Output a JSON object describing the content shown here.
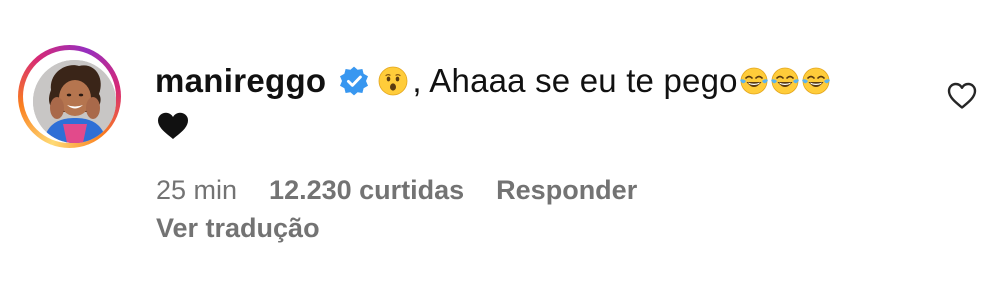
{
  "comment": {
    "username": "manireggo",
    "verified_icon": "verified-badge-icon",
    "reaction_emoji": "astonished-face-emoji",
    "text": ", Ahaaa se eu te pego",
    "trailing_emojis": [
      "face-with-tears-of-joy-emoji",
      "face-with-tears-of-joy-emoji",
      "face-with-tears-of-joy-emoji"
    ],
    "second_line_emoji": "black-heart-emoji",
    "like_icon": "heart-outline-icon",
    "time": "25 min",
    "likes": "12.230 curtidas",
    "reply_label": "Responder",
    "translate_label": "Ver tradução"
  },
  "colors": {
    "text_primary": "#111111",
    "text_secondary": "#737373",
    "verified_blue": "#3897f0",
    "background": "#ffffff"
  }
}
